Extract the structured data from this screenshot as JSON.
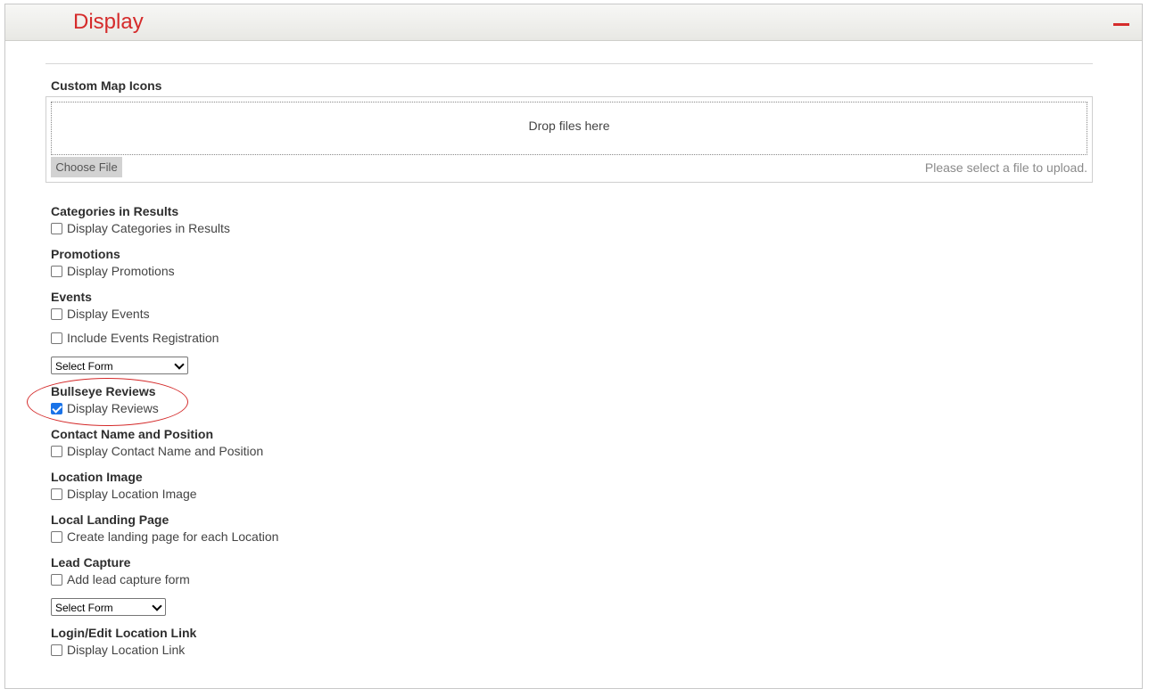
{
  "panel": {
    "title": "Display",
    "collapse_icon": "minus-icon",
    "accent_color": "#d52b2b"
  },
  "upload": {
    "label": "Custom Map Icons",
    "dropzone_text": "Drop files here",
    "choose_button": "Choose File",
    "hint": "Please select a file to upload."
  },
  "sections": {
    "categories": {
      "title": "Categories in Results",
      "checkbox": "Display Categories in Results",
      "checked": false
    },
    "promotions": {
      "title": "Promotions",
      "checkbox": "Display Promotions",
      "checked": false
    },
    "events": {
      "title": "Events",
      "checkbox": "Display Events",
      "checkbox2": "Include Events Registration",
      "select_value": "Select Form"
    },
    "reviews": {
      "title": "Bullseye Reviews",
      "checkbox": "Display Reviews",
      "checked": true
    },
    "contact": {
      "title": "Contact Name and Position",
      "checkbox": "Display Contact Name and Position"
    },
    "location_image": {
      "title": "Location Image",
      "checkbox": "Display Location Image"
    },
    "landing": {
      "title": "Local Landing Page",
      "checkbox": "Create landing page for each Location"
    },
    "lead": {
      "title": "Lead Capture",
      "checkbox": "Add lead capture form",
      "select_value": "Select Form"
    },
    "login": {
      "title": "Login/Edit Location Link",
      "checkbox": "Display Location Link"
    }
  },
  "annotation_color": "#d42a2a"
}
